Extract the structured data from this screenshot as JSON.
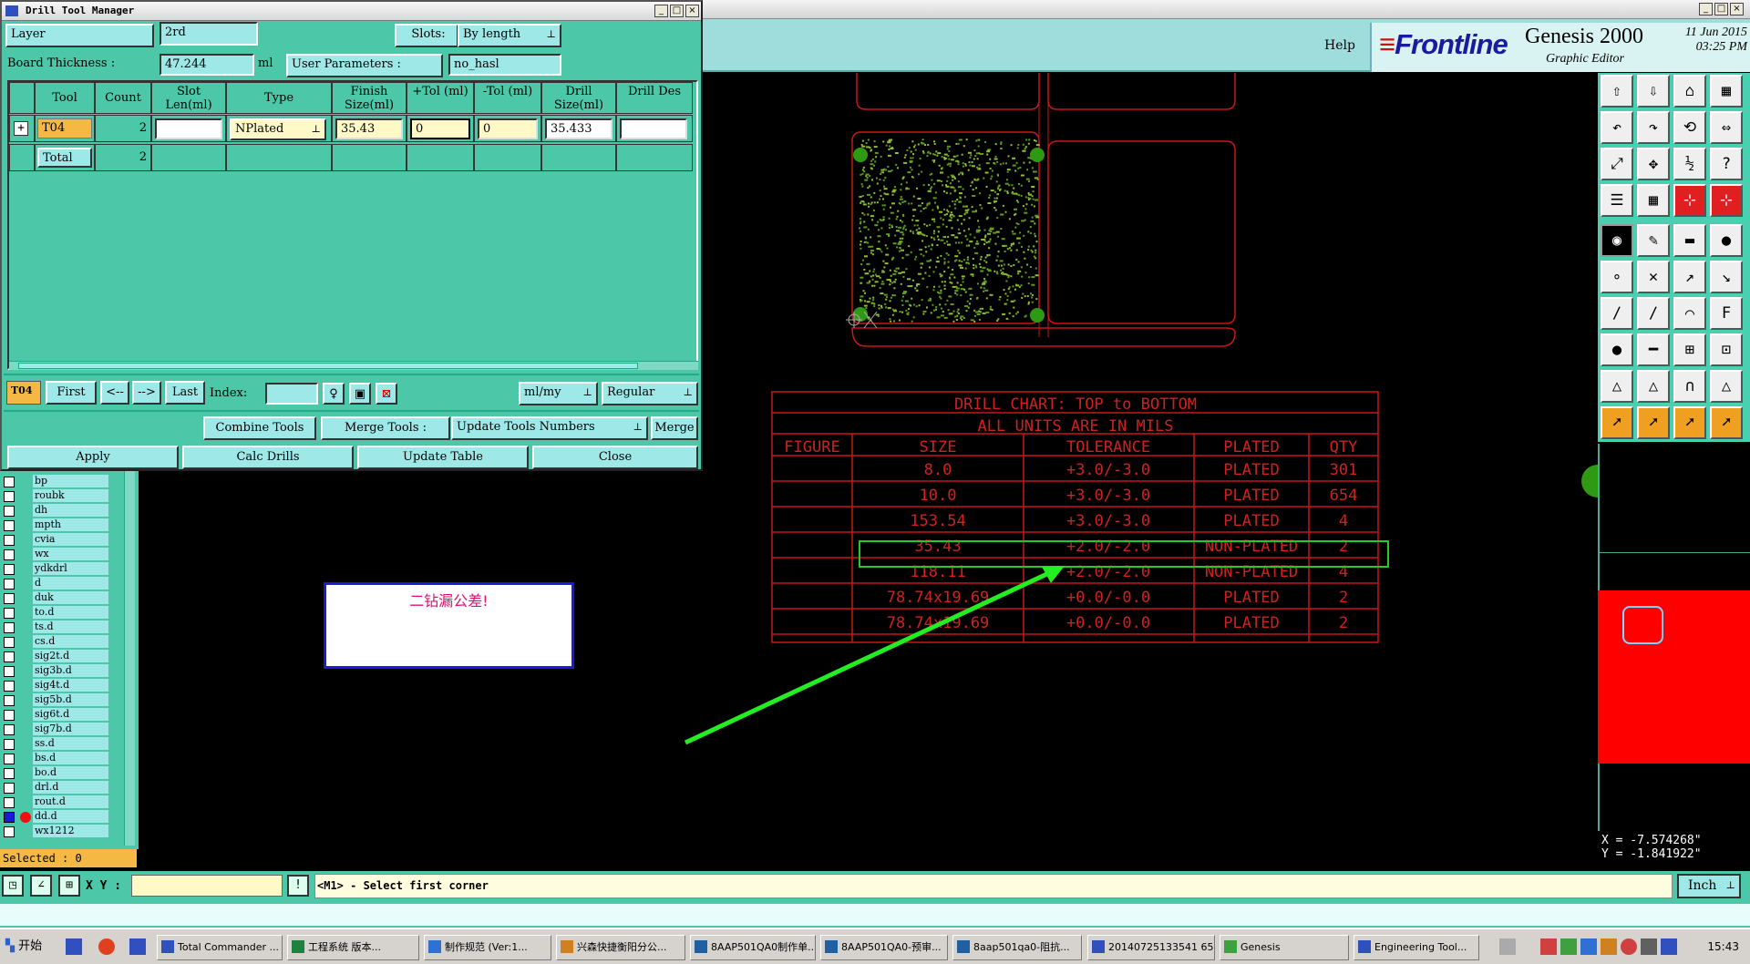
{
  "main_window": {
    "help": "Help",
    "brand_logo": "Frontline",
    "product": "Genesis 2000",
    "subtitle": "Graphic Editor",
    "date": "11 Jun 2015",
    "time": "03:25 PM"
  },
  "drill_tool_manager": {
    "title": "Drill Tool Manager",
    "layer_label": "Layer",
    "layer_value": "2rd",
    "slots_label": "Slots:",
    "slots_value": "By length",
    "board_thickness_label": "Board Thickness :",
    "board_thickness_value": "47.244",
    "board_thickness_unit": "ml",
    "user_params_label": "User Parameters :",
    "user_params_value": "no_hasl",
    "columns": [
      "Tool",
      "Count",
      "Slot Len(ml)",
      "Type",
      "Finish Size(ml)",
      "+Tol (ml)",
      "-Tol (ml)",
      "Drill Size(ml)",
      "Drill Des"
    ],
    "row": {
      "tool": "T04",
      "count": "2",
      "slot_len": "",
      "type": "NPlated",
      "finish_size": "35.43",
      "plus_tol": "0",
      "minus_tol": "0",
      "drill_size": "35.433",
      "drill_des": ""
    },
    "total_label": "Total",
    "total_count": "2",
    "current_tool": "T04",
    "nav": {
      "first": "First",
      "prev": "<--",
      "next": "-->",
      "last": "Last"
    },
    "index_label": "Index:",
    "units": "ml/my",
    "mode": "Regular",
    "combine_tools": "Combine Tools",
    "merge_tools": "Merge Tools :",
    "update_tools_numbers": "Update Tools Numbers",
    "merge": "Merge",
    "apply": "Apply",
    "calc_drills": "Calc Drills",
    "update_table": "Update Table",
    "close": "Close"
  },
  "drill_chart": {
    "title": "DRILL CHART: TOP to BOTTOM",
    "subtitle": "ALL UNITS ARE IN MILS",
    "headers": [
      "FIGURE",
      "SIZE",
      "TOLERANCE",
      "PLATED",
      "QTY"
    ],
    "rows": [
      {
        "size": "8.0",
        "tol": "+3.0/-3.0",
        "plated": "PLATED",
        "qty": "301"
      },
      {
        "size": "10.0",
        "tol": "+3.0/-3.0",
        "plated": "PLATED",
        "qty": "654"
      },
      {
        "size": "153.54",
        "tol": "+3.0/-3.0",
        "plated": "PLATED",
        "qty": "4"
      },
      {
        "size": "35.43",
        "tol": "+2.0/-2.0",
        "plated": "NON-PLATED",
        "qty": "2"
      },
      {
        "size": "118.11",
        "tol": "+2.0/-2.0",
        "plated": "NON-PLATED",
        "qty": "4"
      },
      {
        "size": "78.74x19.69",
        "tol": "+0.0/-0.0",
        "plated": "PLATED",
        "qty": "2"
      },
      {
        "size": "78.74x19.69",
        "tol": "+0.0/-0.0",
        "plated": "PLATED",
        "qty": "2"
      }
    ],
    "highlighted_row": 3
  },
  "message": "二钻漏公差!",
  "layers": [
    "bp",
    "roubk",
    "dh",
    "mpth",
    "cvia",
    "wx",
    "ydkdrl",
    "d",
    "duk",
    "to.d",
    "ts.d",
    "cs.d",
    "sig2t.d",
    "sig3b.d",
    "sig4t.d",
    "sig5b.d",
    "sig6t.d",
    "sig7b.d",
    "ss.d",
    "bs.d",
    "bo.d",
    "drl.d",
    "rout.d",
    "dd.d",
    "wx1212"
  ],
  "active_layer": "dd.d",
  "selected": "Selected : 0",
  "coords": {
    "x": "X = -7.574268\"",
    "y": "Y = -1.841922\""
  },
  "command": {
    "xy_label": "X Y :",
    "prompt": "<M1> - Select first corner",
    "units": "Inch"
  },
  "taskbar": {
    "start": "开始",
    "tasks": [
      "Total Commander ...",
      "工程系统   版本...",
      "制作规范 (Ver:1...",
      "兴森快捷衡阳分公...",
      "8AAP501QA0制作单...",
      "8AAP501QA0-预审...",
      "8aap501qa0-阻抗...",
      "20140725133541 65...",
      "Genesis",
      "Engineering Tool..."
    ],
    "clock": "15:43"
  },
  "colors": {
    "panel": "#4cc8a8",
    "board_outline": "#c81818",
    "highlight": "#22dd22",
    "message_text": "#e01070"
  }
}
